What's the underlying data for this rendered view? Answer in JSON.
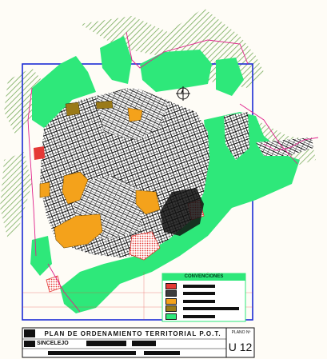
{
  "map": {
    "legend": {
      "title": "CONVENCIONES",
      "items": [
        {
          "swatch": "#e53935",
          "label_blocked": true
        },
        {
          "swatch": "#3c3c3c",
          "label_blocked": true
        },
        {
          "swatch": "#f4a21b",
          "label_blocked": true
        },
        {
          "swatch": "#9a7a18",
          "label_blocked": true
        },
        {
          "swatch": "#2ee87a",
          "label_blocked": true
        }
      ]
    },
    "title_block": {
      "title": "PLAN DE ORDENAMIENTO TERRITORIAL P.O.T.",
      "city": "SINCELEJO",
      "sheet_label": "PLANO Nº",
      "sheet_number": "U 12"
    },
    "colors": {
      "green_zone": "#2ee87a",
      "frame_blue": "#1a2bd6",
      "street_black": "#111111",
      "hatch_green": "#5a9a3a",
      "orange_zone": "#f4a21b",
      "red_zone": "#e53935",
      "magenta_line": "#e0208a"
    }
  }
}
